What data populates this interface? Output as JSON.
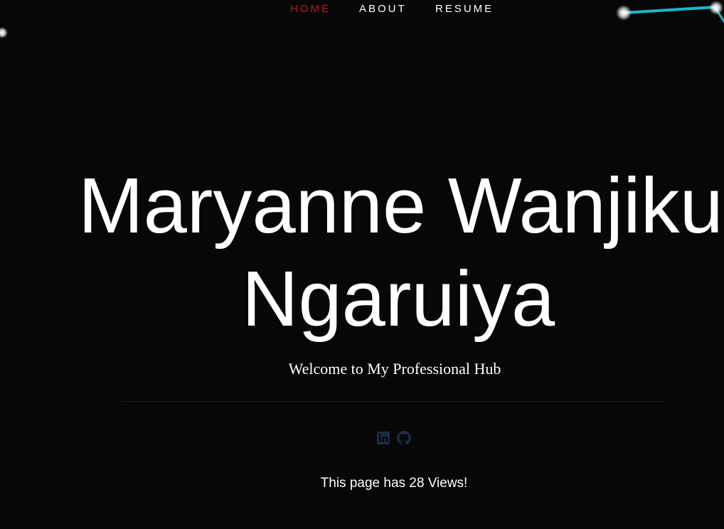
{
  "nav": {
    "items": [
      {
        "label": "HOME",
        "active": true
      },
      {
        "label": "ABOUT",
        "active": false
      },
      {
        "label": "RESUME",
        "active": false
      }
    ],
    "active_color": "#c0141e"
  },
  "hero": {
    "name_line1": "Maryanne Wanjiku",
    "name_line2": "Ngaruiya",
    "tagline": "Welcome to My Professional Hub"
  },
  "socials": [
    {
      "icon": "linkedin-icon"
    },
    {
      "icon": "github-icon"
    }
  ],
  "footer": {
    "views_text": "This page has 28 Views!"
  },
  "colors": {
    "background": "#070708",
    "icon": "#1e2a4a",
    "particle_line": "#1ab8c4"
  }
}
